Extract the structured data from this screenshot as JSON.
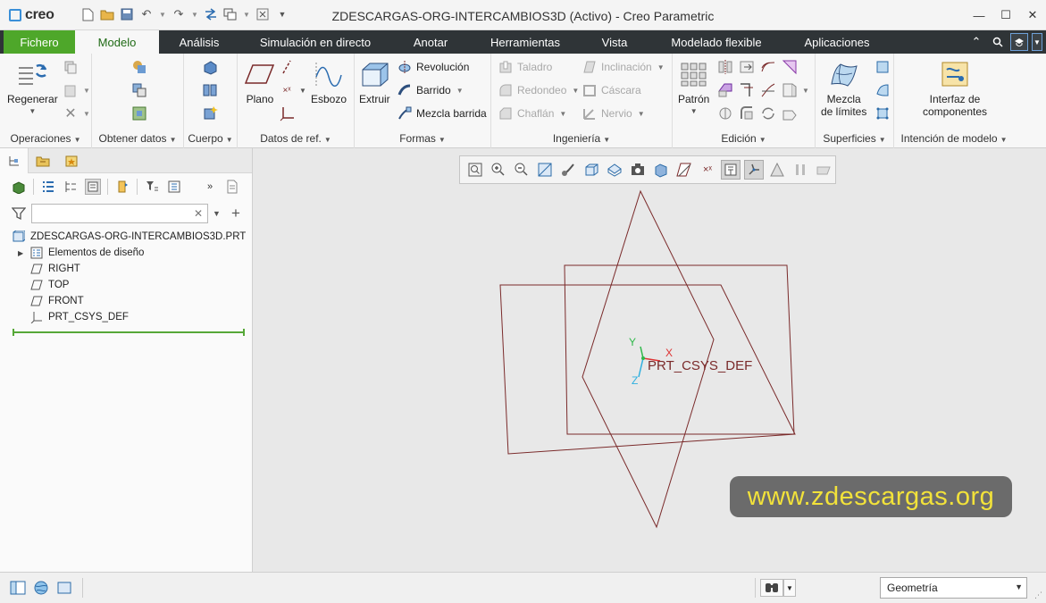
{
  "app": {
    "logo_text": "creo",
    "window_title": "ZDESCARGAS-ORG-INTERCAMBIOS3D (Activo) - Creo Parametric"
  },
  "tabs": [
    {
      "label": "Fichero"
    },
    {
      "label": "Modelo"
    },
    {
      "label": "Análisis"
    },
    {
      "label": "Simulación en directo"
    },
    {
      "label": "Anotar"
    },
    {
      "label": "Herramientas"
    },
    {
      "label": "Vista"
    },
    {
      "label": "Modelado flexible"
    },
    {
      "label": "Aplicaciones"
    }
  ],
  "ribbon": {
    "operaciones": {
      "label": "Operaciones",
      "regenerar": "Regenerar"
    },
    "obtener": {
      "label": "Obtener datos"
    },
    "cuerpo": {
      "label": "Cuerpo"
    },
    "datos_ref": {
      "label": "Datos de ref.",
      "plano": "Plano",
      "esbozo": "Esbozo"
    },
    "formas": {
      "label": "Formas",
      "extruir": "Extruir",
      "revolucion": "Revolución",
      "barrido": "Barrido",
      "mezcla_barrida": "Mezcla barrida"
    },
    "ingenieria": {
      "label": "Ingeniería",
      "taladro": "Taladro",
      "redondeo": "Redondeo",
      "chaflan": "Chaflán",
      "inclinacion": "Inclinación",
      "cascara": "Cáscara",
      "nervio": "Nervio"
    },
    "edicion": {
      "label": "Edición",
      "patron": "Patrón"
    },
    "superficies": {
      "label": "Superficies",
      "mezcla_line1": "Mezcla",
      "mezcla_line2": "de límites"
    },
    "intencion": {
      "label": "Intención de modelo",
      "interfaz_line1": "Interfaz de",
      "interfaz_line2": "componentes"
    }
  },
  "model_tree": {
    "filter_value": "",
    "items": [
      {
        "label": "ZDESCARGAS-ORG-INTERCAMBIOS3D.PRT"
      },
      {
        "label": "Elementos de diseño"
      },
      {
        "label": "RIGHT"
      },
      {
        "label": "TOP"
      },
      {
        "label": "FRONT"
      },
      {
        "label": "PRT_CSYS_DEF"
      }
    ]
  },
  "graphics": {
    "csys_label": "PRT_CSYS_DEF",
    "axis_x": "X",
    "axis_y": "Y",
    "axis_z": "Z",
    "watermark": "www.zdescargas.org",
    "datum_color": "#7a2a2a"
  },
  "statusbar": {
    "filter_value": "Geometría"
  }
}
